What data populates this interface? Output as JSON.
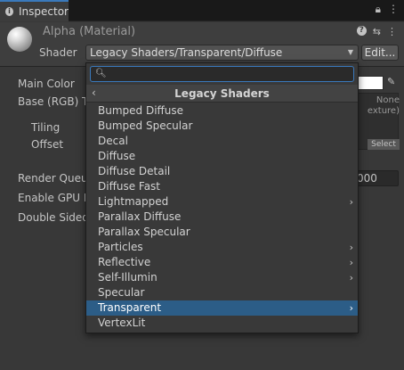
{
  "tab": {
    "label": "Inspector",
    "icon": "info-icon"
  },
  "tabbar_icons": {
    "lock": "🔒",
    "menu": "⋮"
  },
  "header": {
    "title": "Alpha (Material)",
    "shader_label": "Shader",
    "shader_value": "Legacy Shaders/Transparent/Diffuse",
    "edit_label": "Edit..."
  },
  "properties": {
    "main_color": "Main Color",
    "base_rgb": "Base (RGB) T",
    "tiling": "Tiling",
    "offset": "Offset",
    "render_queue": "Render Queue",
    "enable_gpu": "Enable GPU In",
    "double_sided": "Double Sided",
    "texture_none_1": "None",
    "texture_none_2": "exture)",
    "select_label": "Select",
    "queue_value": "000"
  },
  "popup": {
    "search_placeholder": "",
    "title": "Legacy Shaders",
    "items": [
      {
        "label": "Bumped Diffuse",
        "submenu": false
      },
      {
        "label": "Bumped Specular",
        "submenu": false
      },
      {
        "label": "Decal",
        "submenu": false
      },
      {
        "label": "Diffuse",
        "submenu": false
      },
      {
        "label": "Diffuse Detail",
        "submenu": false
      },
      {
        "label": "Diffuse Fast",
        "submenu": false
      },
      {
        "label": "Lightmapped",
        "submenu": true
      },
      {
        "label": "Parallax Diffuse",
        "submenu": false
      },
      {
        "label": "Parallax Specular",
        "submenu": false
      },
      {
        "label": "Particles",
        "submenu": true
      },
      {
        "label": "Reflective",
        "submenu": true
      },
      {
        "label": "Self-Illumin",
        "submenu": true
      },
      {
        "label": "Specular",
        "submenu": false
      },
      {
        "label": "Transparent",
        "submenu": true,
        "selected": true
      },
      {
        "label": "VertexLit",
        "submenu": false
      }
    ]
  },
  "colors": {
    "accent": "#3a79bb",
    "selected_row": "#2c5d87",
    "main_color_swatch": "#ffffff"
  }
}
